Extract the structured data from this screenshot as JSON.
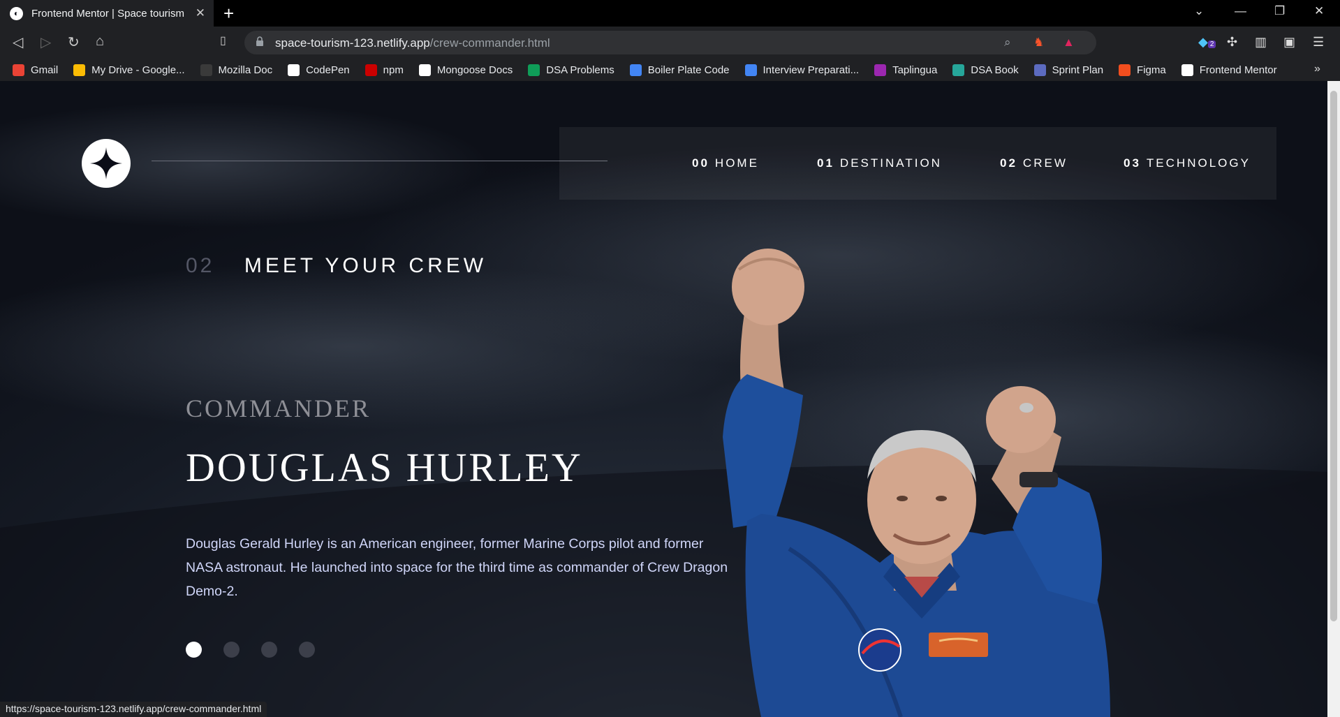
{
  "browser": {
    "tab_title": "Frontend Mentor | Space tourism",
    "url_host": "space-tourism-123.netlify.app",
    "url_path": "/crew-commander.html",
    "extension_badge": "2",
    "status_url": "https://space-tourism-123.netlify.app/crew-commander.html",
    "bookmarks": [
      {
        "label": "Gmail",
        "color": "#ea4335"
      },
      {
        "label": "My Drive - Google...",
        "color": "#fbbc04"
      },
      {
        "label": "Mozilla Doc",
        "color": "#3a3a3a"
      },
      {
        "label": "CodePen",
        "color": "#ffffff"
      },
      {
        "label": "npm",
        "color": "#cb0000"
      },
      {
        "label": "Mongoose Docs",
        "color": "#ffffff"
      },
      {
        "label": "DSA Problems",
        "color": "#0f9d58"
      },
      {
        "label": "Boiler Plate Code",
        "color": "#4285f4"
      },
      {
        "label": "Interview Preparati...",
        "color": "#4285f4"
      },
      {
        "label": "Taplingua",
        "color": "#9c27b0"
      },
      {
        "label": "DSA Book",
        "color": "#26a69a"
      },
      {
        "label": "Sprint Plan",
        "color": "#5c6bc0"
      },
      {
        "label": "Figma",
        "color": "#f24e1e"
      },
      {
        "label": "Frontend Mentor",
        "color": "#ffffff"
      }
    ]
  },
  "nav": {
    "items": [
      {
        "num": "00",
        "label": "HOME"
      },
      {
        "num": "01",
        "label": "DESTINATION"
      },
      {
        "num": "02",
        "label": "CREW"
      },
      {
        "num": "03",
        "label": "TECHNOLOGY"
      }
    ]
  },
  "section": {
    "num": "02",
    "title": "MEET YOUR CREW"
  },
  "crew": {
    "role": "COMMANDER",
    "name": "DOUGLAS HURLEY",
    "bio": "Douglas Gerald Hurley is an American engineer, former Marine Corps pilot and former NASA astronaut. He launched into space for the third time as commander of Crew Dragon Demo-2.",
    "active_index": 0,
    "count": 4
  },
  "colors": {
    "accent": "#ffffff",
    "muted": "#545766",
    "body": "#d0d6f9"
  }
}
